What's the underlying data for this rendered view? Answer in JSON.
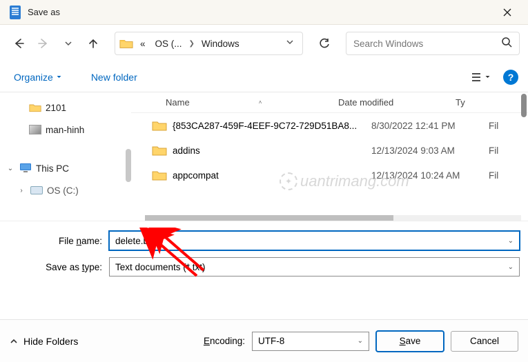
{
  "window": {
    "title": "Save as"
  },
  "breadcrumb": {
    "seg1": "OS (...",
    "seg2": "Windows"
  },
  "search": {
    "placeholder": "Search Windows"
  },
  "toolbar": {
    "organize": "Organize",
    "newfolder": "New folder"
  },
  "tree": {
    "items": [
      {
        "label": "2101",
        "kind": "folder"
      },
      {
        "label": "man-hinh",
        "kind": "image"
      },
      {
        "label": "This PC",
        "kind": "pc"
      },
      {
        "label": "OS (C:)",
        "kind": "drive"
      }
    ]
  },
  "columns": {
    "name": "Name",
    "date": "Date modified",
    "type": "Ty"
  },
  "files": [
    {
      "name": "{853CA287-459F-4EEF-9C72-729D51BA8...",
      "date": "8/30/2022 12:41 PM",
      "type": "Fil"
    },
    {
      "name": "addins",
      "date": "12/13/2024 9:03 AM",
      "type": "Fil"
    },
    {
      "name": "appcompat",
      "date": "12/13/2024 10:24 AM",
      "type": "Fil"
    }
  ],
  "form": {
    "filename_label_pre": "File ",
    "filename_label_ul": "n",
    "filename_label_post": "ame:",
    "filename_value": "delete.bat",
    "type_label_pre": "Save as ",
    "type_label_ul": "t",
    "type_label_post": "ype:",
    "type_value": "Text documents (*.txt)"
  },
  "footer": {
    "hidefolders": "Hide Folders",
    "encoding_label_ul": "E",
    "encoding_label_post": "ncoding:",
    "encoding_value": "UTF-8",
    "save_ul": "S",
    "save_post": "ave",
    "cancel": "Cancel"
  },
  "watermark": "uantrimang.com"
}
